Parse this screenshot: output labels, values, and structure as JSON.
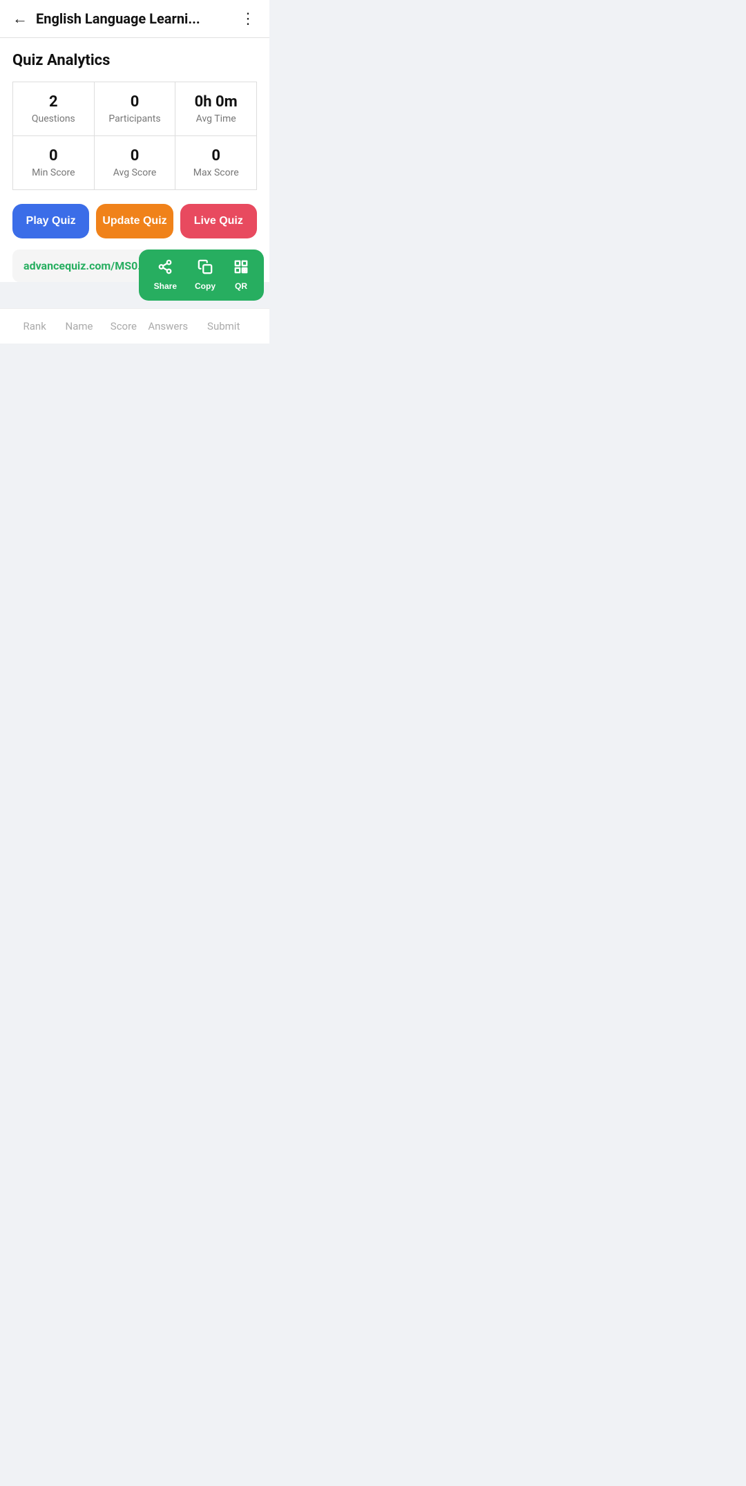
{
  "topBar": {
    "title": "English Language Learni...",
    "backLabel": "←",
    "moreLabel": "⋮"
  },
  "page": {
    "sectionTitle": "Quiz Analytics"
  },
  "stats": {
    "row1": [
      {
        "value": "2",
        "label": "Questions"
      },
      {
        "value": "0",
        "label": "Participants"
      },
      {
        "value": "0h 0m",
        "label": "Avg Time"
      }
    ],
    "row2": [
      {
        "value": "0",
        "label": "Min Score"
      },
      {
        "value": "0",
        "label": "Avg Score"
      },
      {
        "value": "0",
        "label": "Max Score"
      }
    ]
  },
  "buttons": {
    "play": "Play Quiz",
    "update": "Update Quiz",
    "live": "Live Quiz"
  },
  "urlBar": {
    "url": "advancequiz.com/MS0..."
  },
  "sharePopup": {
    "share": "Share",
    "copy": "Copy",
    "qr": "QR"
  },
  "table": {
    "columns": [
      "Rank",
      "Name",
      "Score",
      "Answers",
      "Submit"
    ]
  }
}
